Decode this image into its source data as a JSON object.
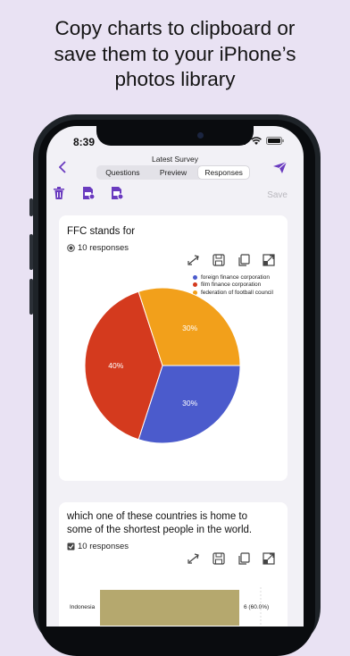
{
  "headline": [
    "Copy charts to clipboard or",
    "save them to your iPhone’s",
    "photos library"
  ],
  "status": {
    "time": "8:39"
  },
  "nav": {
    "title": "Latest Survey",
    "tabs": [
      "Questions",
      "Preview",
      "Responses"
    ],
    "active_tab": "Responses"
  },
  "toolbar": {
    "save_label": "Save"
  },
  "colors": {
    "accent": "#6a3bbf",
    "blue": "#4b5bcc",
    "red": "#d43a1e",
    "orange": "#f2a01b",
    "bar": "#b5a86e"
  },
  "cards": [
    {
      "question": "FFC stands for",
      "responses": "10 responses",
      "chart_data": {
        "type": "pie",
        "categories": [
          "foreign finance corporation",
          "film finance corporation",
          "federation of football council"
        ],
        "values": [
          30,
          40,
          30
        ],
        "labels": [
          "30%",
          "40%",
          "30%"
        ],
        "legend": "top-right"
      }
    },
    {
      "question_lines": [
        "which one of these countries is home to",
        "some of the shortest people in the world."
      ],
      "responses": "10 responses",
      "chart_data": {
        "type": "bar",
        "categories": [
          "Indonesia"
        ],
        "values": [
          6
        ],
        "labels": [
          "6 (60.0%)"
        ]
      }
    }
  ]
}
